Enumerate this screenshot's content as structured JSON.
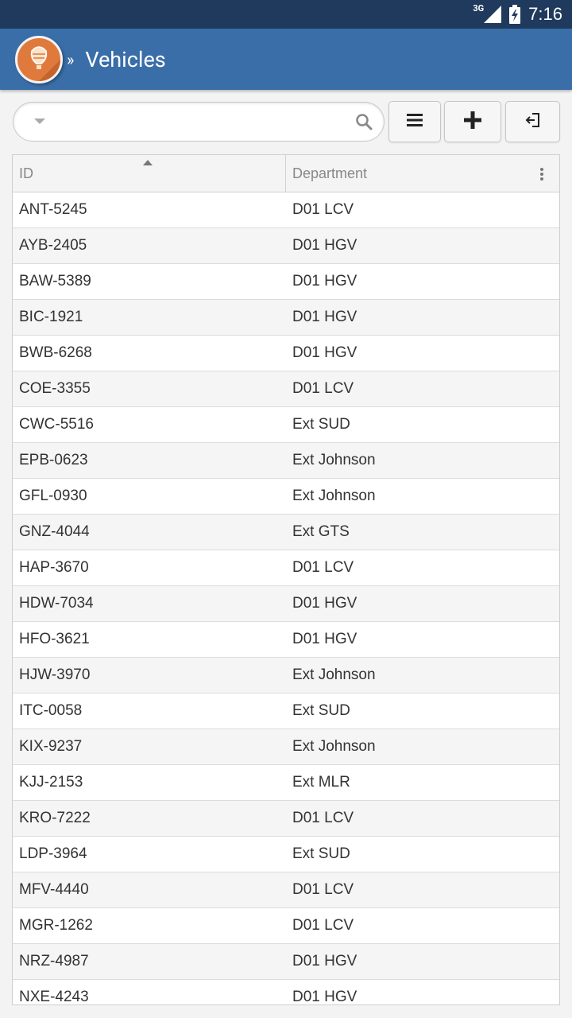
{
  "status_bar": {
    "network": "3G",
    "time": "7:16"
  },
  "header": {
    "title": "Vehicles",
    "chevron": "»"
  },
  "search": {
    "placeholder": "",
    "value": ""
  },
  "toolbar": {
    "menu_icon": "menu-icon",
    "add_icon": "plus-icon",
    "logout_icon": "logout-icon"
  },
  "grid": {
    "columns": [
      {
        "label": "ID",
        "sort": "asc"
      },
      {
        "label": "Department"
      }
    ],
    "rows": [
      {
        "id": "ANT-5245",
        "department": "D01 LCV"
      },
      {
        "id": "AYB-2405",
        "department": "D01 HGV"
      },
      {
        "id": "BAW-5389",
        "department": "D01 HGV"
      },
      {
        "id": "BIC-1921",
        "department": "D01 HGV"
      },
      {
        "id": "BWB-6268",
        "department": "D01 HGV"
      },
      {
        "id": "COE-3355",
        "department": "D01 LCV"
      },
      {
        "id": "CWC-5516",
        "department": "Ext SUD"
      },
      {
        "id": "EPB-0623",
        "department": "Ext Johnson"
      },
      {
        "id": "GFL-0930",
        "department": "Ext Johnson"
      },
      {
        "id": "GNZ-4044",
        "department": "Ext GTS"
      },
      {
        "id": "HAP-3670",
        "department": "D01 LCV"
      },
      {
        "id": "HDW-7034",
        "department": "D01 HGV"
      },
      {
        "id": "HFO-3621",
        "department": "D01 HGV"
      },
      {
        "id": "HJW-3970",
        "department": "Ext Johnson"
      },
      {
        "id": "ITC-0058",
        "department": "Ext SUD"
      },
      {
        "id": "KIX-9237",
        "department": "Ext Johnson"
      },
      {
        "id": "KJJ-2153",
        "department": "Ext MLR"
      },
      {
        "id": "KRO-7222",
        "department": "D01 LCV"
      },
      {
        "id": "LDP-3964",
        "department": "Ext SUD"
      },
      {
        "id": "MFV-4440",
        "department": "D01 LCV"
      },
      {
        "id": "MGR-1262",
        "department": "D01 LCV"
      },
      {
        "id": "NRZ-4987",
        "department": "D01 HGV"
      },
      {
        "id": "NXE-4243",
        "department": "D01 HGV"
      }
    ]
  },
  "colors": {
    "status_bar": "#1f3a5c",
    "header": "#3a6ea8",
    "logo": "#e07a3c"
  }
}
